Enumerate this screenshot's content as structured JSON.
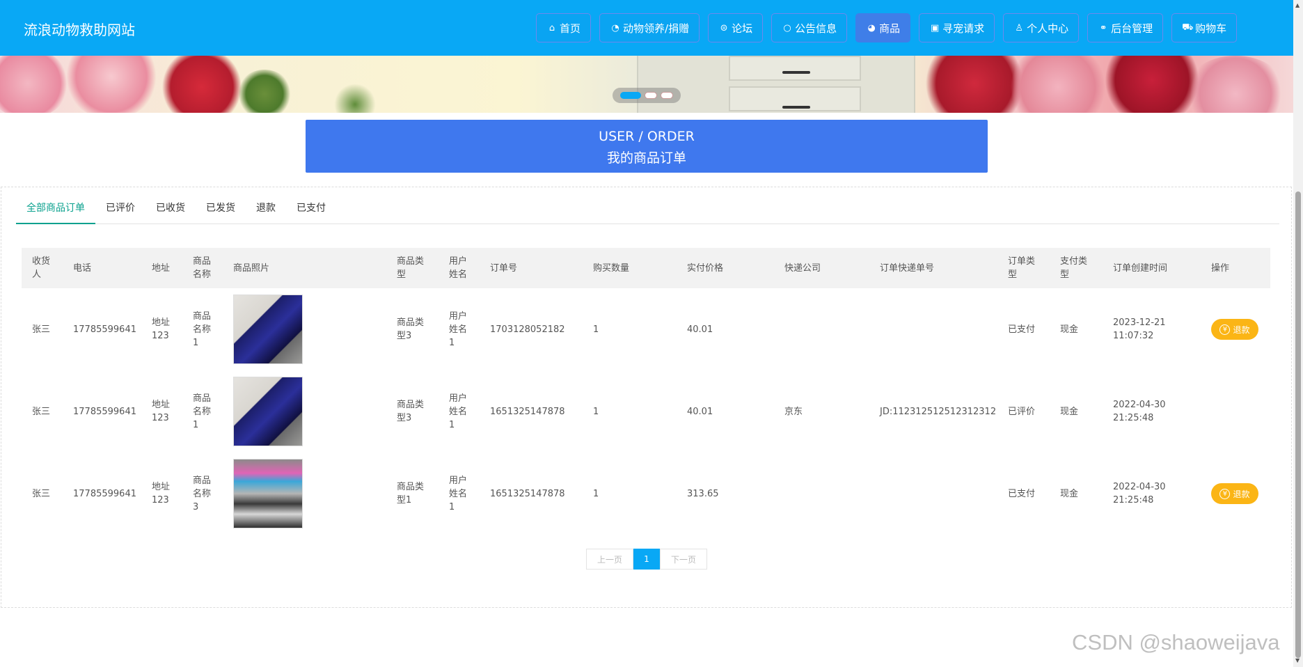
{
  "header": {
    "site_title": "流浪动物救助网站",
    "nav": [
      {
        "icon": "home-icon",
        "glyph": "⌂",
        "label": "首页"
      },
      {
        "icon": "donate-icon",
        "glyph": "◔",
        "label": "动物领养/捐赠"
      },
      {
        "icon": "forum-icon",
        "glyph": "⊜",
        "label": "论坛"
      },
      {
        "icon": "chat-icon",
        "glyph": "○",
        "label": "公告信息"
      },
      {
        "icon": "palette-icon",
        "glyph": "◕",
        "label": "商品"
      },
      {
        "icon": "gift-icon",
        "glyph": "▣",
        "label": "寻宠请求"
      },
      {
        "icon": "user-icon",
        "glyph": "♙",
        "label": "个人中心"
      },
      {
        "icon": "link-icon",
        "glyph": "⚭",
        "label": "后台管理"
      },
      {
        "icon": "cart-icon",
        "glyph": "⛟",
        "label": "购物车"
      }
    ]
  },
  "title_box": {
    "en": "USER / ORDER",
    "cn": "我的商品订单"
  },
  "tabs": [
    "全部商品订单",
    "已评价",
    "已收货",
    "已发货",
    "退款",
    "已支付"
  ],
  "table": {
    "headers": [
      "收货人",
      "电话",
      "地址",
      "商品名称",
      "商品照片",
      "商品类型",
      "用户姓名",
      "订单号",
      "购买数量",
      "实付价格",
      "快递公司",
      "订单快递单号",
      "订单类型",
      "支付类型",
      "订单创建时间",
      "操作"
    ],
    "rows": [
      {
        "receiver": "张三",
        "phone": "17785599641",
        "address": "地址123",
        "product_name": "商品名称1",
        "product_type": "商品类型3",
        "user_name": "用户姓名1",
        "order_no": "1703128052182",
        "quantity": "1",
        "price": "40.01",
        "courier": "",
        "tracking_no": "",
        "order_type": "已支付",
        "pay_type": "现金",
        "created_date": "2023-12-21",
        "created_time": "11:07:32",
        "action": "退款"
      },
      {
        "receiver": "张三",
        "phone": "17785599641",
        "address": "地址123",
        "product_name": "商品名称1",
        "product_type": "商品类型3",
        "user_name": "用户姓名1",
        "order_no": "1651325147878",
        "quantity": "1",
        "price": "40.01",
        "courier": "京东",
        "tracking_no": "JD:112312512512312312",
        "order_type": "已评价",
        "pay_type": "现金",
        "created_date": "2022-04-30",
        "created_time": "21:25:48",
        "action": ""
      },
      {
        "receiver": "张三",
        "phone": "17785599641",
        "address": "地址123",
        "product_name": "商品名称3",
        "product_type": "商品类型1",
        "user_name": "用户姓名1",
        "order_no": "1651325147878",
        "quantity": "1",
        "price": "313.65",
        "courier": "",
        "tracking_no": "",
        "order_type": "已支付",
        "pay_type": "现金",
        "created_date": "2022-04-30",
        "created_time": "21:25:48",
        "action": "退款"
      }
    ]
  },
  "pagination": {
    "prev": "上一页",
    "current": "1",
    "next": "下一页"
  },
  "watermark": "CSDN @shaoweijava",
  "colors": {
    "header": "#09a8f5",
    "title_box": "#3f78ee",
    "tab_active": "#0aa18e",
    "refund": "#fbb515"
  }
}
